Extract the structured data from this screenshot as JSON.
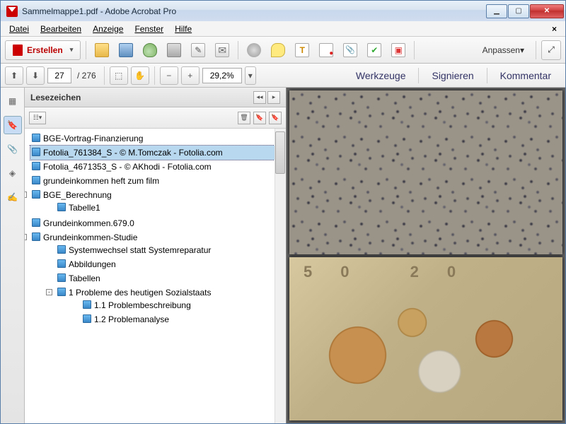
{
  "window": {
    "title": "Sammelmappe1.pdf - Adobe Acrobat Pro"
  },
  "menu": {
    "items": [
      "Datei",
      "Bearbeiten",
      "Anzeige",
      "Fenster",
      "Hilfe"
    ]
  },
  "toolbar": {
    "create": "Erstellen",
    "customize": "Anpassen"
  },
  "nav": {
    "page_current": "27",
    "page_total": "/ 276",
    "zoom": "29,2%",
    "tools": "Werkzeuge",
    "sign": "Signieren",
    "comment": "Kommentar"
  },
  "panel": {
    "title": "Lesezeichen"
  },
  "bookmarks": [
    {
      "label": "BGE-Vortrag-Finanzierung",
      "level": 0
    },
    {
      "label": "Fotolia_761384_S - © M.Tomczak - Fotolia.com",
      "level": 0,
      "selected": true
    },
    {
      "label": "Fotolia_4671353_S - © AKhodi - Fotolia.com",
      "level": 0
    },
    {
      "label": "grundeinkommen heft zum film",
      "level": 0
    },
    {
      "label": "BGE_Berechnung",
      "level": 0,
      "expandable": "-"
    },
    {
      "label": "Tabelle1",
      "level": 1
    },
    {
      "label": "Grundeinkommen.679.0",
      "level": 0
    },
    {
      "label": "Grundeinkommen-Studie",
      "level": 0,
      "expandable": "-"
    },
    {
      "label": "Systemwechsel statt Systemreparatur",
      "level": 1
    },
    {
      "label": "Abbildungen",
      "level": 1
    },
    {
      "label": "Tabellen",
      "level": 1
    },
    {
      "label": "1  Probleme des heutigen Sozialstaats",
      "level": 1,
      "expandable": "-"
    },
    {
      "label": "1.1 Problembeschreibung",
      "level": 2
    },
    {
      "label": "1.2 Problemanalyse",
      "level": 2
    }
  ]
}
